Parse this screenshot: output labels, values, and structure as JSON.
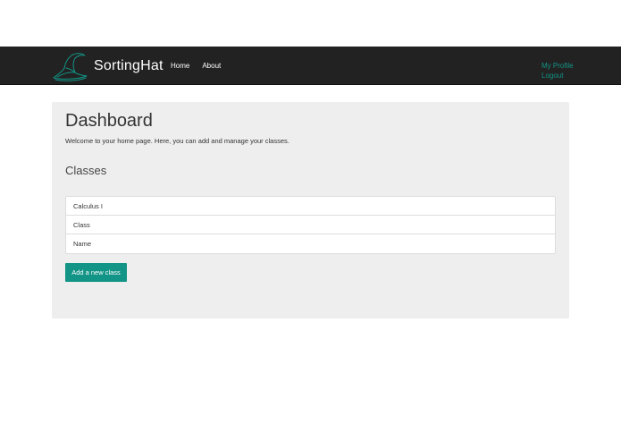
{
  "navbar": {
    "brand": "SortingHat",
    "logo_icon": "wizard-hat-icon",
    "links": [
      {
        "label": "Home"
      },
      {
        "label": "About"
      }
    ],
    "right_links": [
      {
        "label": "My Profile"
      },
      {
        "label": "Logout"
      }
    ],
    "accent_color": "#129486",
    "background_color": "#222222"
  },
  "main": {
    "title": "Dashboard",
    "welcome": "Welcome to your home page. Here, you can add and manage your classes.",
    "classes_heading": "Classes",
    "classes": [
      {
        "label": "Calculus I"
      },
      {
        "label": "Class"
      },
      {
        "label": "Name"
      }
    ],
    "add_button_label": "Add a new class",
    "panel_color": "#eeeeee"
  }
}
